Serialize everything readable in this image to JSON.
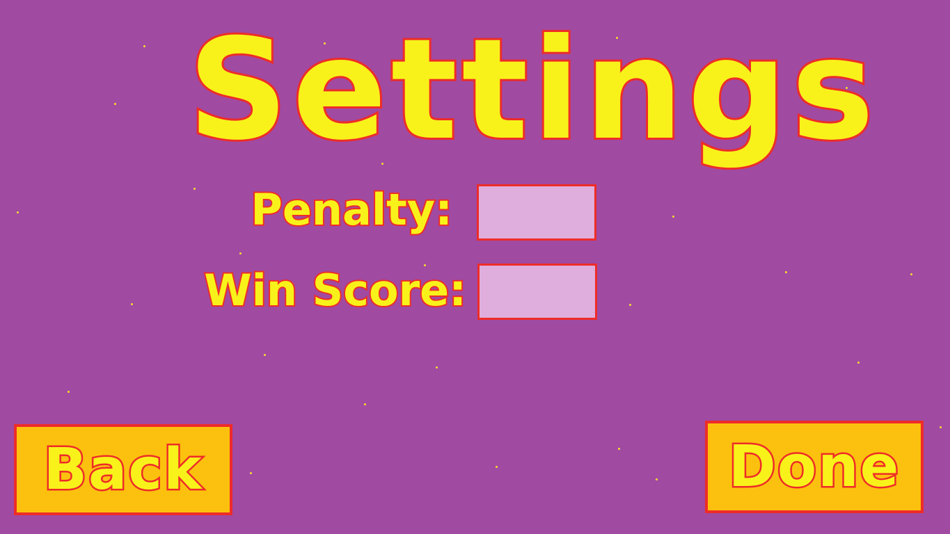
{
  "title": "Settings",
  "penalty": {
    "label": "Penalty:",
    "value": ""
  },
  "win_score": {
    "label": "Win Score:",
    "value": ""
  },
  "buttons": {
    "back": "Back",
    "done": "Done"
  },
  "colors": {
    "background": "#a04aa2",
    "text_fill": "#f8f21a",
    "outline": "#ee2c28",
    "button_fill": "#fcc10e",
    "field_fill": "#dfaedc"
  }
}
